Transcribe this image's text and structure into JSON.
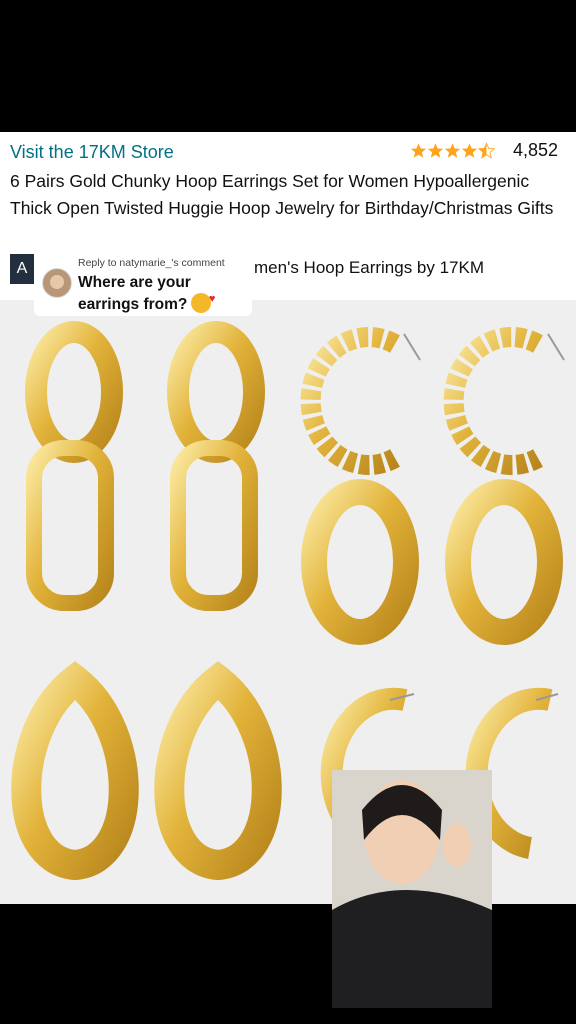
{
  "product": {
    "store_link": "Visit the 17KM Store",
    "rating_count": "4,852",
    "rating_stars": 4.5,
    "title": "6 Pairs Gold Chunky Hoop Earrings Set for Women Hypoallergenic Thick Open Twisted Huggie Hoop Jewelry for Birthday/Christmas Gifts",
    "badge_letter": "A",
    "subline": "men's Hoop Earrings by 17KM"
  },
  "reply": {
    "meta": "Reply to natymarie_'s comment",
    "text": "Where are your earrings from?"
  },
  "colors": {
    "link": "#007185",
    "star": "#ffa41c",
    "gold": "#e2b33a"
  },
  "icons": [
    "star-icon",
    "emoji-icon"
  ]
}
